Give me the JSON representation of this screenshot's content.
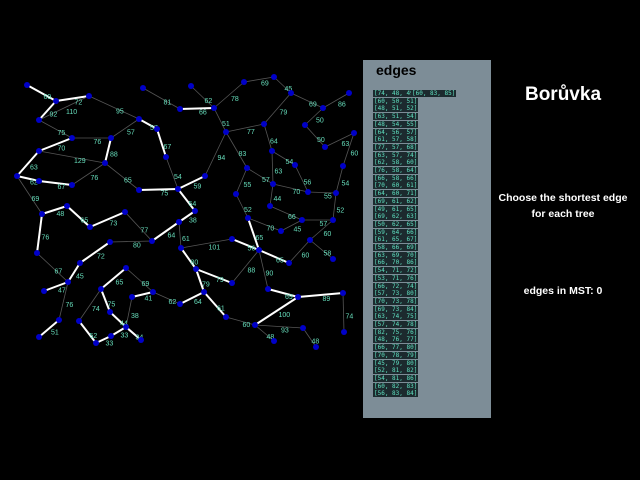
{
  "panel": {
    "title": "edges",
    "edges_col1": [
      "[74, 48, 49]",
      "[60, 50, 51]",
      "[48, 51, 52]",
      "[63, 51, 54]",
      "[48, 54, 55]",
      "[64, 56, 57]",
      "[61, 57, 58]",
      "[77, 57, 68]",
      "[63, 57, 74]",
      "[62, 58, 60]",
      "[76, 58, 64]",
      "[66, 58, 66]",
      "[70, 60, 61]",
      "[64, 60, 71]",
      "[69, 61, 62]",
      "[49, 61, 65]",
      "[69, 62, 63]",
      "[50, 62, 65]",
      "[59, 64, 66]",
      "[61, 65, 67]",
      "[58, 66, 69]",
      "[63, 69, 70]",
      "[66, 70, 86]",
      "[54, 71, 72]",
      "[53, 71, 76]",
      "[66, 72, 74]",
      "[57, 73, 80]",
      "[70, 73, 78]",
      "[69, 73, 84]",
      "[63, 74, 75]",
      "[57, 74, 78]",
      "[82, 75, 76]",
      "[48, 76, 77]",
      "[66, 77, 80]",
      "[70, 78, 79]",
      "[45, 79, 80]",
      "[52, 81, 82]",
      "[54, 81, 86]",
      "[60, 82, 83]",
      "[56, 83, 84]"
    ],
    "edges_col2": [
      "[60, 83, 85]"
    ]
  },
  "title": "Borůvka",
  "instruction_line1": "Choose the shortest edge",
  "instruction_line2": "for each tree",
  "mst_count_label": "edges in MST: 0",
  "colors": {
    "node": "#0000c8",
    "edge": "#555555",
    "mst_edge": "#ffffff",
    "weight_label": "#66ddbb",
    "panel": "#7d8d97"
  },
  "graph": {
    "edges": [
      [
        "A",
        "B",
        69,
        1
      ],
      [
        "B",
        "C",
        72,
        1
      ],
      [
        "B",
        "D",
        92,
        1
      ],
      [
        "C",
        "D",
        110,
        0
      ],
      [
        "C",
        "L",
        95,
        0
      ],
      [
        "D",
        "E",
        75,
        0
      ],
      [
        "E",
        "F",
        76,
        0
      ],
      [
        "E",
        "G",
        70,
        1
      ],
      [
        "F",
        "H",
        88,
        1
      ],
      [
        "G",
        "H",
        129,
        0
      ],
      [
        "G",
        "I",
        63,
        1
      ],
      [
        "I",
        "J",
        62,
        1
      ],
      [
        "J",
        "K",
        67,
        1
      ],
      [
        "K",
        "H",
        76,
        0
      ],
      [
        "H",
        "O",
        65,
        0
      ],
      [
        "O",
        "P",
        75,
        1
      ],
      [
        "L",
        "M",
        57,
        1
      ],
      [
        "L",
        "F",
        57,
        0
      ],
      [
        "M",
        "N",
        67,
        1
      ],
      [
        "N",
        "P",
        54,
        0
      ],
      [
        "Q",
        "S",
        81,
        0
      ],
      [
        "S",
        "T",
        66,
        1
      ],
      [
        "R",
        "T",
        62,
        0
      ],
      [
        "T",
        "U",
        78,
        0
      ],
      [
        "U",
        "V",
        69,
        0
      ],
      [
        "V",
        "W",
        45,
        0
      ],
      [
        "W",
        "X",
        69,
        0
      ],
      [
        "X",
        "Y",
        86,
        0
      ],
      [
        "X",
        "Z",
        50,
        0
      ],
      [
        "Z",
        "AC",
        50,
        0
      ],
      [
        "AC",
        "AD",
        63,
        0
      ],
      [
        "AD",
        "AE",
        60,
        0
      ],
      [
        "AE",
        "AM",
        54,
        0
      ],
      [
        "T",
        "AB",
        51,
        0
      ],
      [
        "AB",
        "AA",
        77,
        0
      ],
      [
        "AA",
        "W",
        79,
        0
      ],
      [
        "AA",
        "AF",
        64,
        0
      ],
      [
        "AF",
        "AG",
        54,
        0
      ],
      [
        "AG",
        "AL",
        56,
        0
      ],
      [
        "AL",
        "AM",
        55,
        0
      ],
      [
        "AB",
        "AH",
        83,
        0
      ],
      [
        "AH",
        "AJ",
        57,
        0
      ],
      [
        "AF",
        "AJ",
        63,
        0
      ],
      [
        "AJ",
        "AL",
        70,
        0
      ],
      [
        "AJ",
        "AN",
        44,
        0
      ],
      [
        "AH",
        "AK",
        55,
        0
      ],
      [
        "AB",
        "AI",
        94,
        0
      ],
      [
        "AI",
        "P",
        59,
        1
      ],
      [
        "P",
        "CA",
        54,
        1
      ],
      [
        "CA",
        "CB",
        38,
        1
      ],
      [
        "AK",
        "CC",
        52,
        0
      ],
      [
        "CC",
        "CF",
        70,
        0
      ],
      [
        "AN",
        "CE",
        66,
        0
      ],
      [
        "CF",
        "CE",
        45,
        0
      ],
      [
        "CE",
        "CG",
        57,
        0
      ],
      [
        "CG",
        "CH",
        60,
        0
      ],
      [
        "CH",
        "CI",
        58,
        0
      ],
      [
        "CH",
        "CL",
        60,
        0
      ],
      [
        "CG",
        "AM",
        52,
        0
      ],
      [
        "CC",
        "CK",
        65,
        1
      ],
      [
        "CJ",
        "CK",
        56,
        1
      ],
      [
        "CK",
        "CL",
        65,
        1
      ],
      [
        "CK",
        "CO",
        88,
        0
      ],
      [
        "CK",
        "CR",
        90,
        0
      ],
      [
        "CR",
        "CS",
        69,
        1
      ],
      [
        "CS",
        "CT",
        89,
        1
      ],
      [
        "CT",
        "CX",
        74,
        0
      ],
      [
        "CS",
        "CV",
        100,
        1
      ],
      [
        "CV",
        "CU",
        60,
        0
      ],
      [
        "CV",
        "CW",
        93,
        0
      ],
      [
        "CV",
        "CY",
        48,
        0
      ],
      [
        "CW",
        "CZ",
        48,
        0
      ],
      [
        "CB",
        "CM",
        61,
        0
      ],
      [
        "CM",
        "CJ",
        101,
        0
      ],
      [
        "CM",
        "CN",
        80,
        1
      ],
      [
        "CN",
        "CO",
        79,
        1
      ],
      [
        "CN",
        "CP",
        79,
        1
      ],
      [
        "CP",
        "CQ",
        64,
        1
      ],
      [
        "CP",
        "CU",
        61,
        1
      ],
      [
        "BA",
        "BB",
        48,
        1
      ],
      [
        "BB",
        "BC",
        65,
        1
      ],
      [
        "BC",
        "BD",
        73,
        1
      ],
      [
        "BD",
        "BE",
        77,
        0
      ],
      [
        "BE",
        "BF",
        64,
        1
      ],
      [
        "BA",
        "BH",
        76,
        1
      ],
      [
        "BG",
        "BE",
        80,
        0
      ],
      [
        "BG",
        "BI",
        72,
        1
      ],
      [
        "BI",
        "BJ",
        45,
        1
      ],
      [
        "BH",
        "BJ",
        67,
        0
      ],
      [
        "BJ",
        "BK",
        47,
        1
      ],
      [
        "BJ",
        "BL",
        76,
        0
      ],
      [
        "BL",
        "BM",
        51,
        1
      ],
      [
        "BN",
        "BO",
        65,
        1
      ],
      [
        "BO",
        "BR",
        75,
        1
      ],
      [
        "BR",
        "BT",
        44,
        1
      ],
      [
        "BN",
        "BP",
        69,
        0
      ],
      [
        "BP",
        "BQ",
        41,
        1
      ],
      [
        "BQ",
        "BT",
        38,
        0
      ],
      [
        "BT",
        "BW",
        34,
        1
      ],
      [
        "BT",
        "BU",
        33,
        1
      ],
      [
        "BU",
        "BV",
        33,
        1
      ],
      [
        "BV",
        "BS",
        52,
        1
      ],
      [
        "BS",
        "BO",
        74,
        0
      ],
      [
        "BP",
        "CQ",
        62,
        0
      ],
      [
        "I",
        "BA",
        69,
        0
      ]
    ]
  }
}
